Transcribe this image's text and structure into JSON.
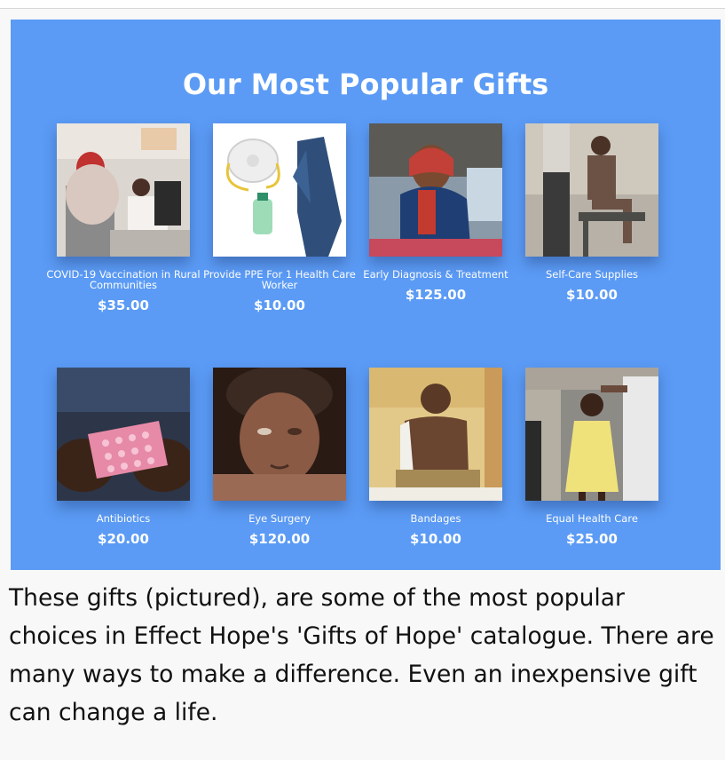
{
  "panel": {
    "title": "Our Most Popular Gifts",
    "background": "#5b9bf5"
  },
  "gifts": [
    {
      "name": "COVID-19 Vaccination in Rural Communities",
      "price": "$35.00"
    },
    {
      "name": "Provide PPE For 1 Health Care Worker",
      "price": "$10.00"
    },
    {
      "name": "Early Diagnosis & Treatment",
      "price": "$125.00"
    },
    {
      "name": "Self-Care Supplies",
      "price": "$10.00"
    },
    {
      "name": "Antibiotics",
      "price": "$20.00"
    },
    {
      "name": "Eye Surgery",
      "price": "$120.00"
    },
    {
      "name": "Bandages",
      "price": "$10.00"
    },
    {
      "name": "Equal Health Care",
      "price": "$25.00"
    }
  ],
  "caption": "These gifts (pictured), are some of the most popular choices in Effect Hope's 'Gifts of Hope' catalogue. There are many ways to make a difference. Even an inexpensive gift can change a life."
}
